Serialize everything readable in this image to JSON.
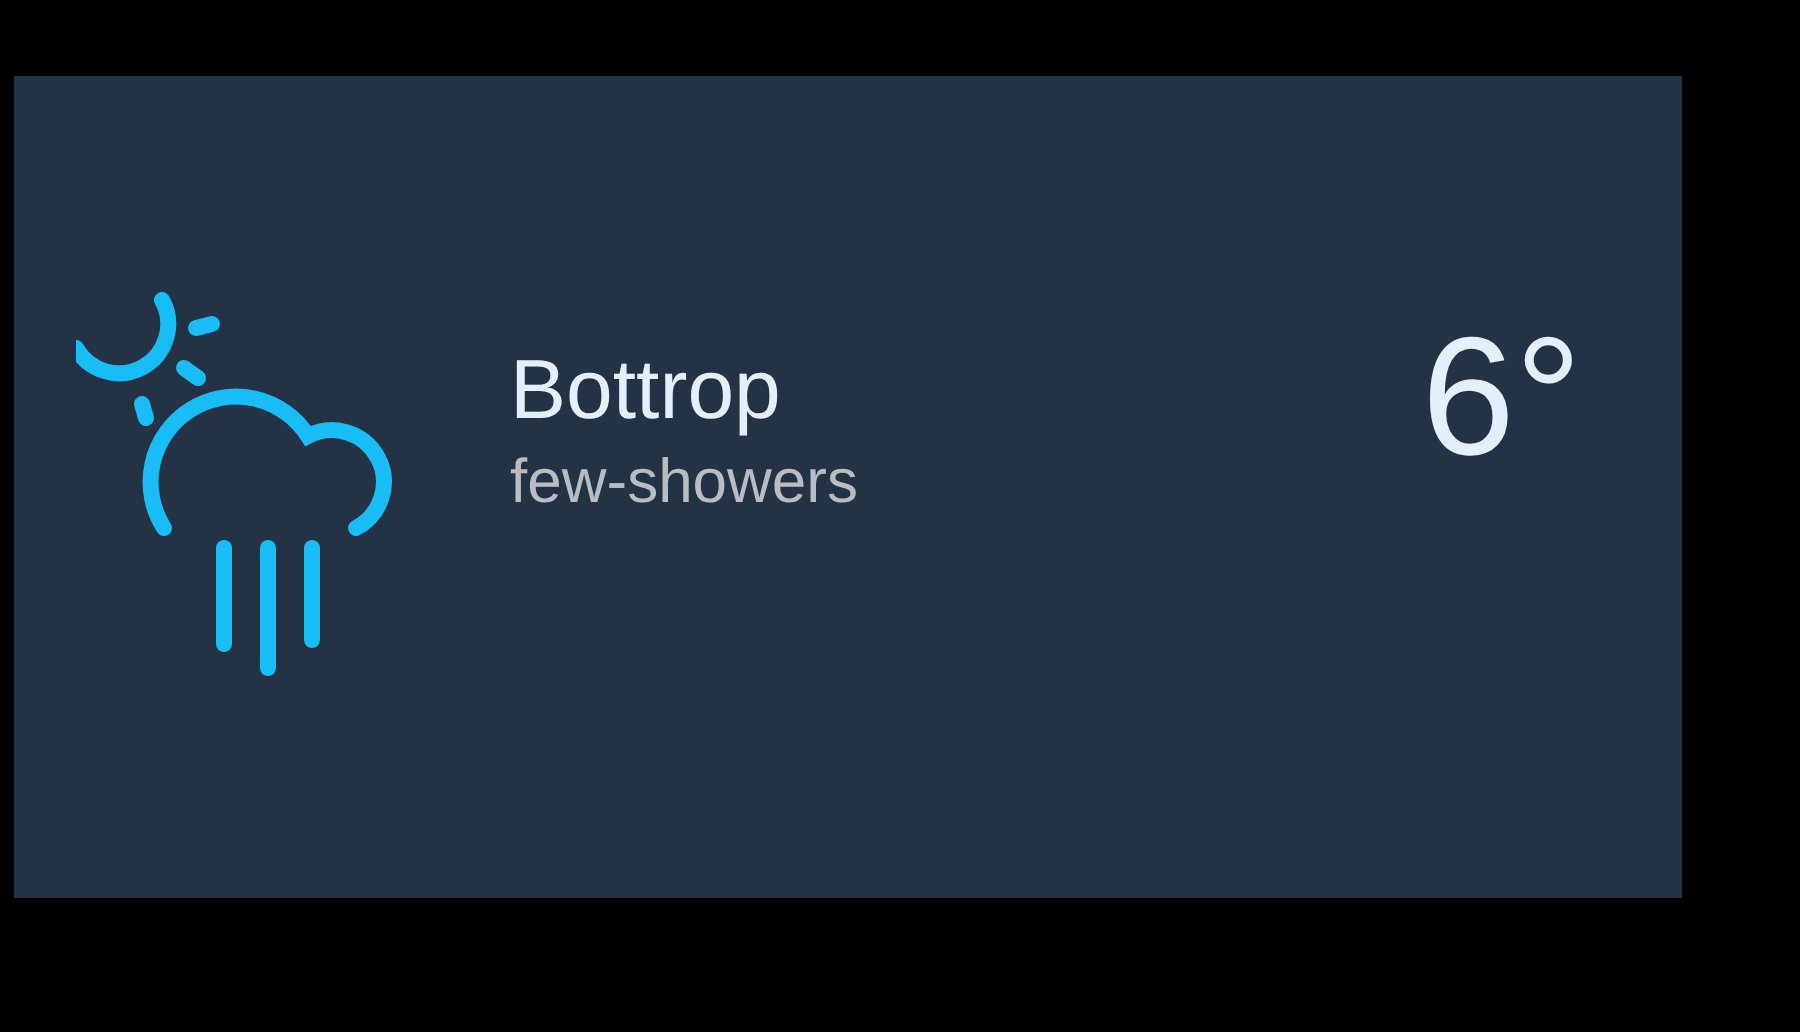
{
  "weather": {
    "city": "Bottrop",
    "condition": "few-showers",
    "temperature": "6°"
  }
}
